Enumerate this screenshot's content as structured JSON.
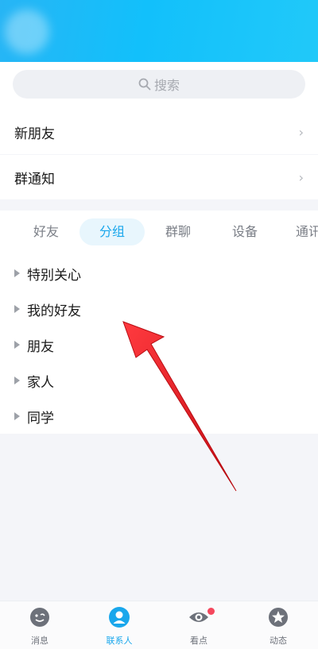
{
  "search": {
    "placeholder": "搜索"
  },
  "rows": [
    {
      "label": "新朋友"
    },
    {
      "label": "群通知"
    }
  ],
  "tabs": [
    {
      "label": "好友",
      "active": false
    },
    {
      "label": "分组",
      "active": true
    },
    {
      "label": "群聊",
      "active": false
    },
    {
      "label": "设备",
      "active": false
    },
    {
      "label": "通讯",
      "active": false
    }
  ],
  "groups": [
    {
      "label": "特别关心"
    },
    {
      "label": "我的好友"
    },
    {
      "label": "朋友"
    },
    {
      "label": "家人"
    },
    {
      "label": "同学"
    }
  ],
  "bottom_nav": [
    {
      "label": "消息",
      "icon": "message-icon"
    },
    {
      "label": "联系人",
      "icon": "contact-icon",
      "active": true
    },
    {
      "label": "看点",
      "icon": "eye-icon",
      "badge": true
    },
    {
      "label": "动态",
      "icon": "star-icon"
    }
  ],
  "colors": {
    "accent": "#1aa7ec",
    "header": "#12c0fb",
    "arrow": "#e8141b",
    "badge": "#f5475d"
  }
}
